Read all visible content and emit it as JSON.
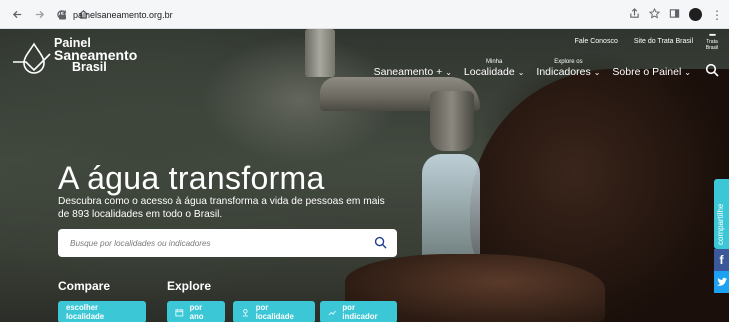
{
  "browser": {
    "url": "painelsaneamento.org.br"
  },
  "header": {
    "logo_lines": [
      "Painel",
      "Saneamento",
      "Brasil"
    ],
    "top_links": [
      "Fale Conosco",
      "Site do Trata Brasil"
    ],
    "partner_logo_text": "Trata Brasil"
  },
  "nav": {
    "items": [
      {
        "small": "",
        "label": "Saneamento +"
      },
      {
        "small": "Minha",
        "label": "Localidade"
      },
      {
        "small": "Explore os",
        "label": "Indicadores"
      },
      {
        "small": "",
        "label": "Sobre o Painel"
      }
    ]
  },
  "hero": {
    "title": "A água transforma",
    "subtitle": "Descubra como o acesso à água transforma a vida de pessoas em mais de 893 localidades em todo o Brasil."
  },
  "search": {
    "placeholder": "Busque por localidades ou indicadores"
  },
  "compare": {
    "label": "Compare",
    "button": "escolher localidade"
  },
  "explore": {
    "label": "Explore",
    "buttons": [
      "por ano",
      "por localidade",
      "por indicador"
    ]
  },
  "share": {
    "label": "compartilhe"
  },
  "colors": {
    "accent": "#3cc7d6",
    "facebook": "#3b5998",
    "twitter": "#1da1f2"
  }
}
